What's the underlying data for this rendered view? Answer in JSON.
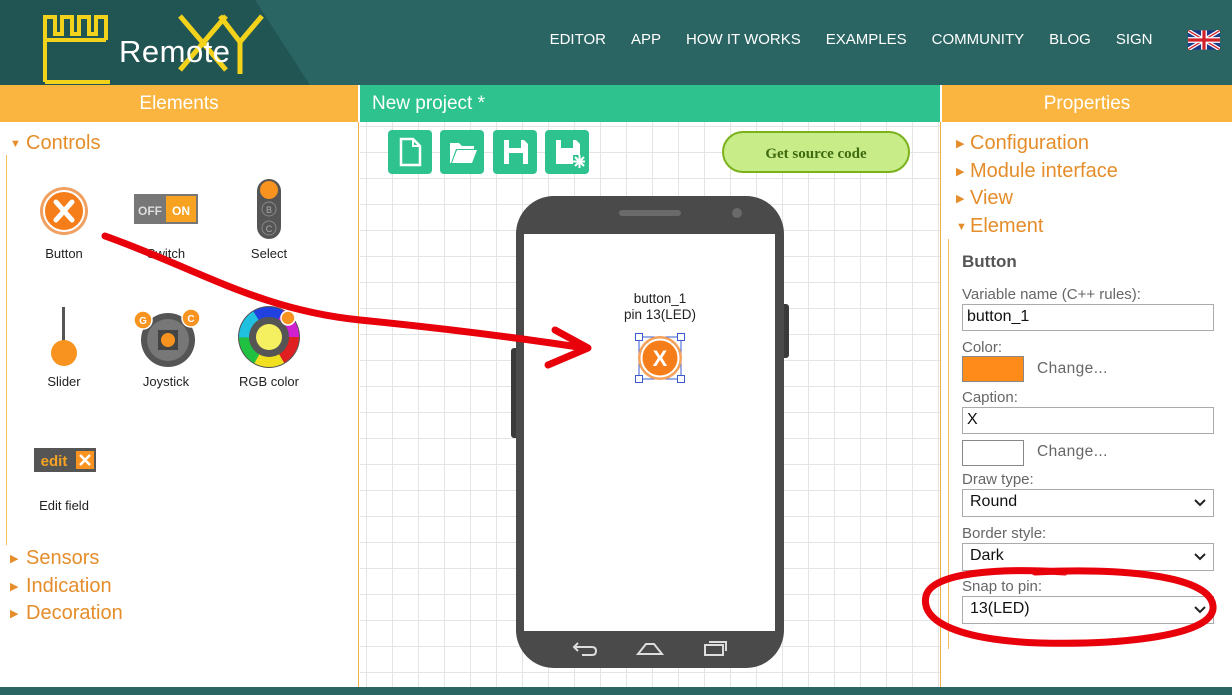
{
  "header": {
    "logo_text": "Remote",
    "nav": [
      "EDITOR",
      "APP",
      "HOW IT WORKS",
      "EXAMPLES",
      "COMMUNITY",
      "BLOG",
      "SIGN"
    ]
  },
  "elements_panel": {
    "title": "Elements",
    "categories": {
      "controls": "Controls",
      "sensors": "Sensors",
      "indication": "Indication",
      "decoration": "Decoration"
    },
    "items": [
      {
        "label": "Button",
        "icon": "button-icon"
      },
      {
        "label": "Switch",
        "icon": "switch-icon"
      },
      {
        "label": "Select",
        "icon": "select-icon"
      },
      {
        "label": "Slider",
        "icon": "slider-icon"
      },
      {
        "label": "Joystick",
        "icon": "joystick-icon"
      },
      {
        "label": "RGB color",
        "icon": "rgb-color-icon"
      },
      {
        "label": "Edit field",
        "icon": "edit-field-icon"
      }
    ],
    "switch_text": {
      "off": "OFF",
      "on": "ON"
    },
    "edit_icon_text": "edit"
  },
  "project": {
    "title": "New project *",
    "get_source_label": "Get source code",
    "phone_button": {
      "name_line": "button_1",
      "pin_line": "pin 13(LED)",
      "caption": "X"
    }
  },
  "properties": {
    "title": "Properties",
    "sections": {
      "configuration": "Configuration",
      "module_interface": "Module interface",
      "view": "View",
      "element": "Element"
    },
    "element_title": "Button",
    "variable_label": "Variable name (C++ rules):",
    "variable_value": "button_1",
    "color_label": "Color:",
    "color_value": "#ff8c1a",
    "change_label": "Change...",
    "caption_label": "Caption:",
    "caption_value": "X",
    "draw_type_label": "Draw type:",
    "draw_type_value": "Round",
    "border_style_label": "Border style:",
    "border_style_value": "Dark",
    "snap_label": "Snap to pin:",
    "snap_value": "13(LED)"
  },
  "colors": {
    "header_bg": "#2a6563",
    "panel_orange": "#f9b53f",
    "panel_green": "#2ec38e",
    "accent_orange": "#e58d2a",
    "annotation_red": "#e8000b"
  }
}
